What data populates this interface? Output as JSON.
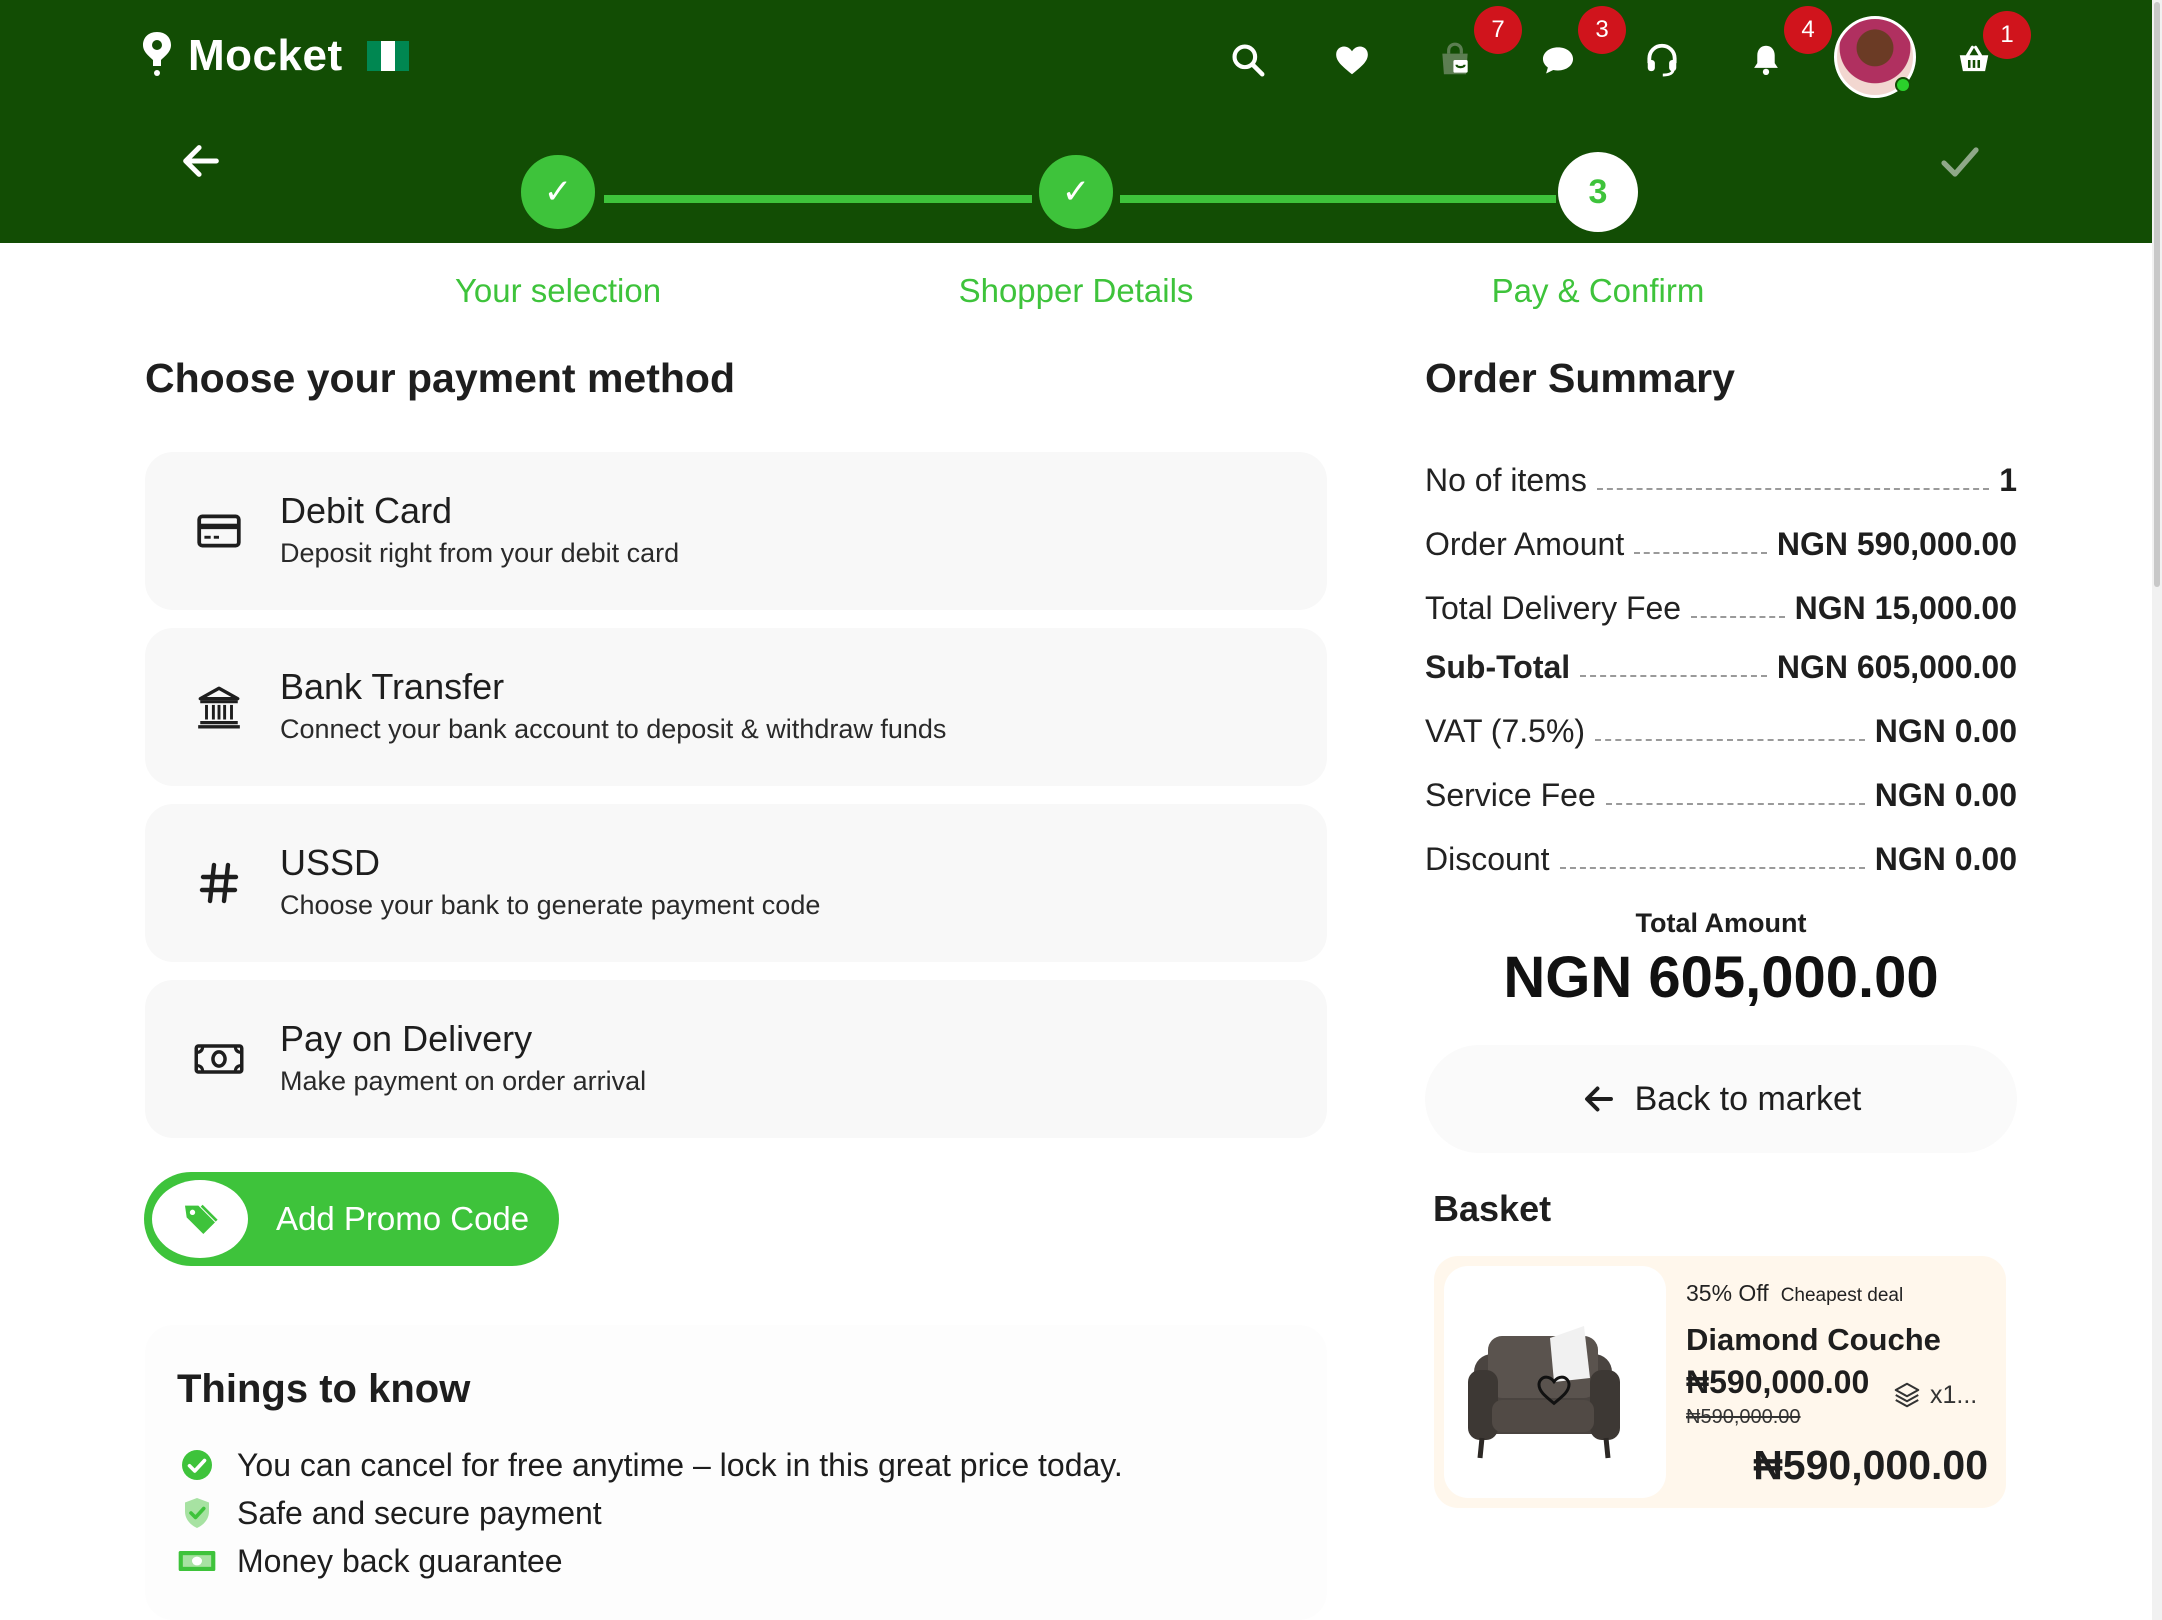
{
  "header": {
    "app_name": "Mocket",
    "flag_colors": [
      "#008751",
      "#ffffff",
      "#008751"
    ],
    "icons": [
      {
        "name": "search-icon",
        "badge": ""
      },
      {
        "name": "heart-icon",
        "badge": ""
      },
      {
        "name": "shopping-bag-icon",
        "badge": "7"
      },
      {
        "name": "chat-icon",
        "badge": "3"
      },
      {
        "name": "headset-icon",
        "badge": ""
      },
      {
        "name": "bell-icon",
        "badge": "4"
      },
      {
        "name": "cart-icon",
        "badge": "1"
      }
    ],
    "badges": {
      "bag": "7",
      "chat": "3",
      "bell": "4",
      "cart": "1"
    }
  },
  "steps": {
    "step3_number": "3",
    "check_glyph": "✓",
    "labels": [
      "Your selection",
      "Shopper Details",
      "Pay & Confirm"
    ]
  },
  "payment": {
    "title": "Choose your payment method",
    "methods": [
      {
        "icon": "credit-card-icon",
        "title": "Debit Card",
        "subtitle": "Deposit right from your debit card"
      },
      {
        "icon": "bank-icon",
        "title": "Bank Transfer",
        "subtitle": "Connect your bank account to deposit & withdraw funds"
      },
      {
        "icon": "hash-icon",
        "title": "USSD",
        "subtitle": "Choose your bank to generate payment code"
      },
      {
        "icon": "cash-icon",
        "title": "Pay on Delivery",
        "subtitle": "Make payment on order arrival"
      }
    ],
    "promo_label": "Add Promo Code"
  },
  "things_to_know": {
    "title": "Things to know",
    "items": [
      {
        "icon": "check-circle-icon",
        "text": "You can cancel for free anytime – lock in this great price today."
      },
      {
        "icon": "shield-check-icon",
        "text": "Safe and secure payment"
      },
      {
        "icon": "money-icon",
        "text": "Money back guarantee"
      }
    ]
  },
  "summary": {
    "title": "Order Summary",
    "rows": [
      {
        "label": "No of items",
        "value": "1"
      },
      {
        "label": "Order Amount",
        "value": "NGN 590,000.00"
      },
      {
        "label": "Total Delivery Fee",
        "value": "NGN 15,000.00"
      },
      {
        "label": "Sub-Total",
        "value": "NGN 605,000.00"
      },
      {
        "label": "VAT (7.5%)",
        "value": "NGN 0.00"
      },
      {
        "label": "Service Fee",
        "value": "NGN 0.00"
      },
      {
        "label": "Discount",
        "value": "NGN 0.00"
      }
    ],
    "total_label": "Total Amount",
    "total_amount": "NGN 605,000.00",
    "back_label": "Back to market"
  },
  "basket": {
    "title": "Basket",
    "item": {
      "discount": "35% Off",
      "deal": "Cheapest deal",
      "name": "Diamond Couche",
      "price": "₦590,000.00",
      "old_price": "₦590,000.00",
      "qty": "x1...",
      "total": "₦590,000.00"
    }
  },
  "colors": {
    "header_bg": "#124d04",
    "accent": "#3ec33b",
    "badge": "#d0141c"
  }
}
